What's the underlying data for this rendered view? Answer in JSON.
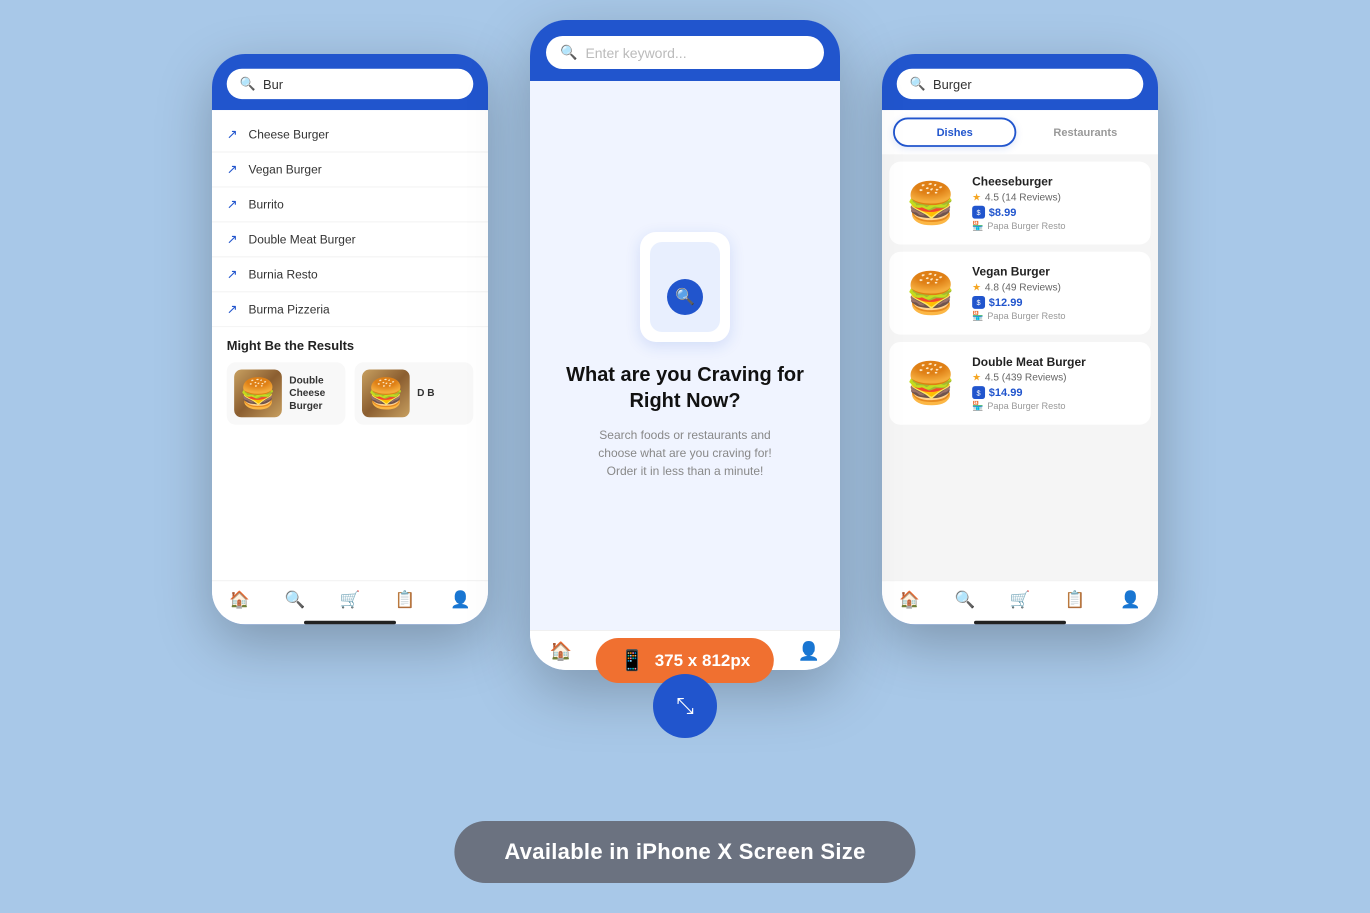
{
  "background": "#a8c8e8",
  "phones": {
    "left": {
      "search_value": "Bur",
      "suggestions": [
        "Cheese Burger",
        "Vegan Burger",
        "Burrito",
        "Double Meat Burger",
        "Burnia Resto",
        "Burma Pizzeria"
      ],
      "results_title": "Might Be the Results",
      "result_cards": [
        {
          "name": "Double Cheese Burger",
          "emoji": "🍔"
        },
        {
          "name": "D B",
          "emoji": "🍔"
        }
      ]
    },
    "center": {
      "search_placeholder": "Enter keyword...",
      "empty_title": "What are you Craving for Right Now?",
      "empty_desc": "Search foods or restaurants and choose what are you craving for! Order it in less than a minute!"
    },
    "right": {
      "search_value": "Burger",
      "tabs": [
        "Dishes",
        "Restaurants"
      ],
      "active_tab": "Dishes",
      "dishes": [
        {
          "name": "Cheeseburger",
          "rating": "4.5",
          "reviews": "14 Reviews",
          "price": "$8.99",
          "restaurant": "Papa Burger Resto",
          "emoji": "🍔"
        },
        {
          "name": "Vegan Burger",
          "rating": "4.8",
          "reviews": "49 Reviews",
          "price": "$12.99",
          "restaurant": "Papa Burger Resto",
          "emoji": "🍔"
        },
        {
          "name": "Double Meat Burger",
          "rating": "4.5",
          "reviews": "439 Reviews",
          "price": "$14.99",
          "restaurant": "Papa Burger Resto",
          "emoji": "🍔"
        }
      ]
    }
  },
  "size_badge": {
    "icon": "📱",
    "text": "375 x 812px"
  },
  "available_banner": {
    "text": "Available in iPhone X Screen Size"
  },
  "nav": {
    "items": [
      "home",
      "search",
      "cart",
      "list",
      "user"
    ]
  }
}
